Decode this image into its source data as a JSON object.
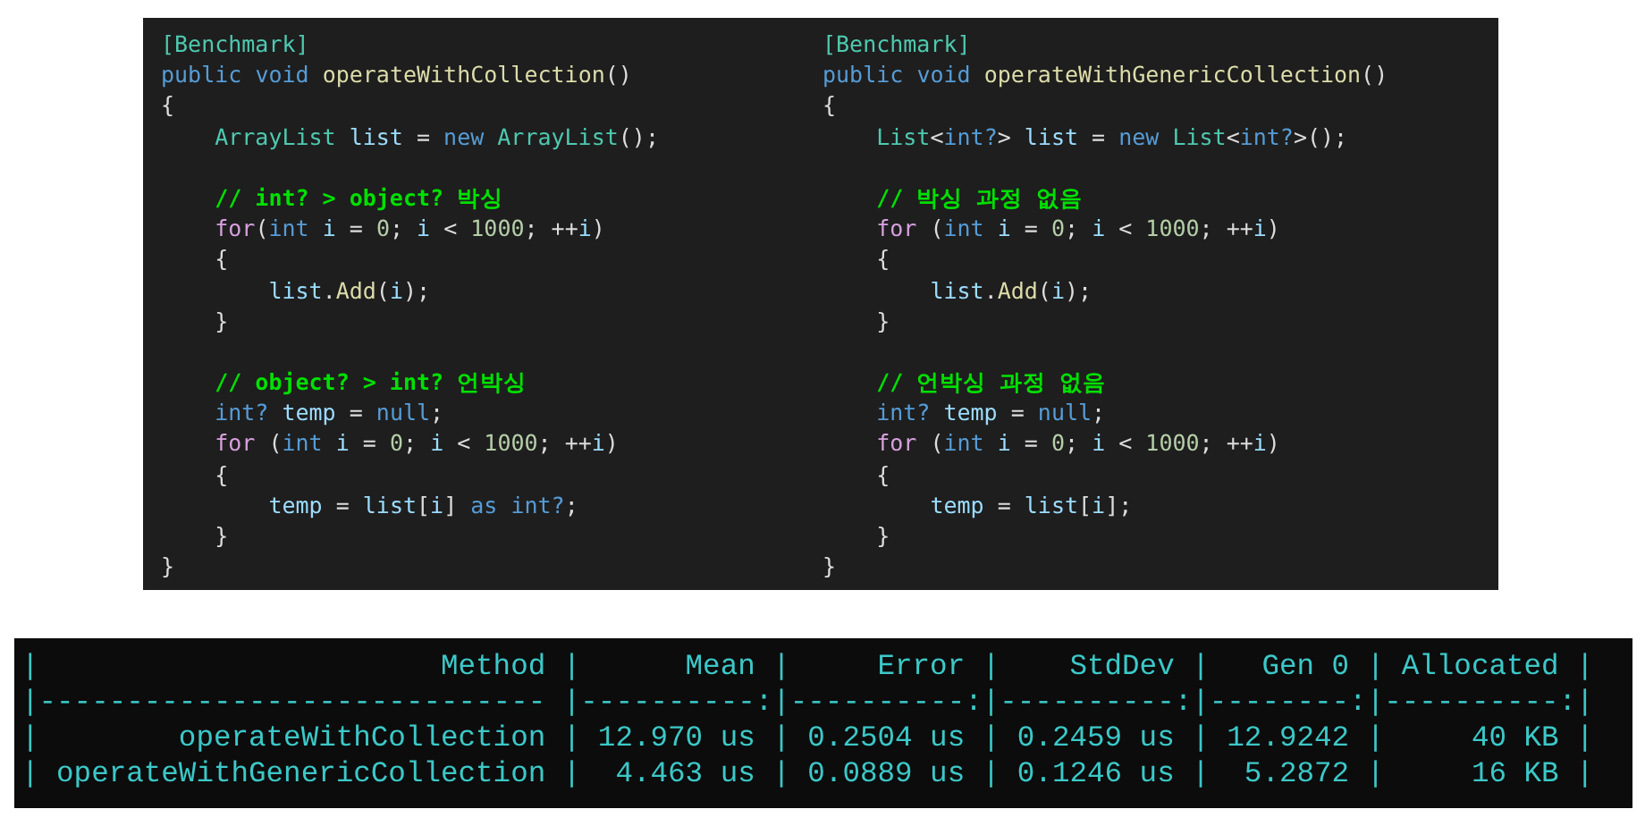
{
  "code_panels": [
    {
      "lines": [
        {
          "kind": "code",
          "tokens": [
            {
              "text": "[Benchmark]",
              "kind": "attr"
            }
          ]
        },
        {
          "kind": "code",
          "tokens": [
            {
              "text": "public ",
              "kind": "keyword"
            },
            {
              "text": "void ",
              "kind": "keyword"
            },
            {
              "text": "operateWithCollection",
              "kind": "method"
            },
            {
              "text": "()",
              "kind": "plain"
            }
          ]
        },
        {
          "kind": "code",
          "tokens": [
            {
              "text": "{",
              "kind": "plain"
            }
          ]
        },
        {
          "kind": "code",
          "tokens": [
            {
              "text": "    ArrayList ",
              "kind": "type"
            },
            {
              "text": "list",
              "kind": "ident"
            },
            {
              "text": " = ",
              "kind": "plain"
            },
            {
              "text": "new ",
              "kind": "keyword"
            },
            {
              "text": "ArrayList",
              "kind": "type"
            },
            {
              "text": "();",
              "kind": "plain"
            }
          ]
        },
        {
          "kind": "blank"
        },
        {
          "kind": "code",
          "tokens": [
            {
              "text": "    // int? > object? 박싱",
              "kind": "comment"
            }
          ]
        },
        {
          "kind": "code",
          "tokens": [
            {
              "text": "    for",
              "kind": "control"
            },
            {
              "text": "(",
              "kind": "plain"
            },
            {
              "text": "int ",
              "kind": "keyword"
            },
            {
              "text": "i",
              "kind": "ident"
            },
            {
              "text": " = ",
              "kind": "plain"
            },
            {
              "text": "0",
              "kind": "number"
            },
            {
              "text": "; ",
              "kind": "plain"
            },
            {
              "text": "i",
              "kind": "ident"
            },
            {
              "text": " < ",
              "kind": "plain"
            },
            {
              "text": "1000",
              "kind": "number"
            },
            {
              "text": "; ++",
              "kind": "plain"
            },
            {
              "text": "i",
              "kind": "ident"
            },
            {
              "text": ")",
              "kind": "plain"
            }
          ]
        },
        {
          "kind": "code",
          "tokens": [
            {
              "text": "    {",
              "kind": "plain"
            }
          ]
        },
        {
          "kind": "code",
          "tokens": [
            {
              "text": "        list",
              "kind": "ident"
            },
            {
              "text": ".",
              "kind": "plain"
            },
            {
              "text": "Add",
              "kind": "method"
            },
            {
              "text": "(",
              "kind": "plain"
            },
            {
              "text": "i",
              "kind": "ident"
            },
            {
              "text": ");",
              "kind": "plain"
            }
          ]
        },
        {
          "kind": "code",
          "tokens": [
            {
              "text": "    }",
              "kind": "plain"
            }
          ]
        },
        {
          "kind": "blank"
        },
        {
          "kind": "code",
          "tokens": [
            {
              "text": "    // object? > int? 언박싱",
              "kind": "comment"
            }
          ]
        },
        {
          "kind": "code",
          "tokens": [
            {
              "text": "    int? ",
              "kind": "keyword"
            },
            {
              "text": "temp",
              "kind": "ident"
            },
            {
              "text": " = ",
              "kind": "plain"
            },
            {
              "text": "null",
              "kind": "keyword"
            },
            {
              "text": ";",
              "kind": "plain"
            }
          ]
        },
        {
          "kind": "code",
          "tokens": [
            {
              "text": "    for",
              "kind": "control"
            },
            {
              "text": " (",
              "kind": "plain"
            },
            {
              "text": "int ",
              "kind": "keyword"
            },
            {
              "text": "i",
              "kind": "ident"
            },
            {
              "text": " = ",
              "kind": "plain"
            },
            {
              "text": "0",
              "kind": "number"
            },
            {
              "text": "; ",
              "kind": "plain"
            },
            {
              "text": "i",
              "kind": "ident"
            },
            {
              "text": " < ",
              "kind": "plain"
            },
            {
              "text": "1000",
              "kind": "number"
            },
            {
              "text": "; ++",
              "kind": "plain"
            },
            {
              "text": "i",
              "kind": "ident"
            },
            {
              "text": ")",
              "kind": "plain"
            }
          ]
        },
        {
          "kind": "code",
          "tokens": [
            {
              "text": "    {",
              "kind": "plain"
            }
          ]
        },
        {
          "kind": "code",
          "tokens": [
            {
              "text": "        temp",
              "kind": "ident"
            },
            {
              "text": " = ",
              "kind": "plain"
            },
            {
              "text": "list",
              "kind": "ident"
            },
            {
              "text": "[",
              "kind": "plain"
            },
            {
              "text": "i",
              "kind": "ident"
            },
            {
              "text": "] ",
              "kind": "plain"
            },
            {
              "text": "as int?",
              "kind": "keyword"
            },
            {
              "text": ";",
              "kind": "plain"
            }
          ]
        },
        {
          "kind": "code",
          "tokens": [
            {
              "text": "    }",
              "kind": "plain"
            }
          ]
        },
        {
          "kind": "code",
          "tokens": [
            {
              "text": "}",
              "kind": "plain"
            }
          ]
        }
      ]
    },
    {
      "lines": [
        {
          "kind": "code",
          "tokens": [
            {
              "text": "[Benchmark]",
              "kind": "attr"
            }
          ]
        },
        {
          "kind": "code",
          "tokens": [
            {
              "text": "public ",
              "kind": "keyword"
            },
            {
              "text": "void ",
              "kind": "keyword"
            },
            {
              "text": "operateWithGenericCollection",
              "kind": "method"
            },
            {
              "text": "()",
              "kind": "plain"
            }
          ]
        },
        {
          "kind": "code",
          "tokens": [
            {
              "text": "{",
              "kind": "plain"
            }
          ]
        },
        {
          "kind": "code",
          "tokens": [
            {
              "text": "    List",
              "kind": "type"
            },
            {
              "text": "<",
              "kind": "plain"
            },
            {
              "text": "int?",
              "kind": "keyword"
            },
            {
              "text": "> ",
              "kind": "plain"
            },
            {
              "text": "list",
              "kind": "ident"
            },
            {
              "text": " = ",
              "kind": "plain"
            },
            {
              "text": "new ",
              "kind": "keyword"
            },
            {
              "text": "List",
              "kind": "type"
            },
            {
              "text": "<",
              "kind": "plain"
            },
            {
              "text": "int?",
              "kind": "keyword"
            },
            {
              "text": ">();",
              "kind": "plain"
            }
          ]
        },
        {
          "kind": "blank"
        },
        {
          "kind": "code",
          "tokens": [
            {
              "text": "    // 박싱 과정 없음",
              "kind": "comment"
            }
          ]
        },
        {
          "kind": "code",
          "tokens": [
            {
              "text": "    for",
              "kind": "control"
            },
            {
              "text": " (",
              "kind": "plain"
            },
            {
              "text": "int ",
              "kind": "keyword"
            },
            {
              "text": "i",
              "kind": "ident"
            },
            {
              "text": " = ",
              "kind": "plain"
            },
            {
              "text": "0",
              "kind": "number"
            },
            {
              "text": "; ",
              "kind": "plain"
            },
            {
              "text": "i",
              "kind": "ident"
            },
            {
              "text": " < ",
              "kind": "plain"
            },
            {
              "text": "1000",
              "kind": "number"
            },
            {
              "text": "; ++",
              "kind": "plain"
            },
            {
              "text": "i",
              "kind": "ident"
            },
            {
              "text": ")",
              "kind": "plain"
            }
          ]
        },
        {
          "kind": "code",
          "tokens": [
            {
              "text": "    {",
              "kind": "plain"
            }
          ]
        },
        {
          "kind": "code",
          "tokens": [
            {
              "text": "        list",
              "kind": "ident"
            },
            {
              "text": ".",
              "kind": "plain"
            },
            {
              "text": "Add",
              "kind": "method"
            },
            {
              "text": "(",
              "kind": "plain"
            },
            {
              "text": "i",
              "kind": "ident"
            },
            {
              "text": ");",
              "kind": "plain"
            }
          ]
        },
        {
          "kind": "code",
          "tokens": [
            {
              "text": "    }",
              "kind": "plain"
            }
          ]
        },
        {
          "kind": "blank"
        },
        {
          "kind": "code",
          "tokens": [
            {
              "text": "    // 언박싱 과정 없음",
              "kind": "comment"
            }
          ]
        },
        {
          "kind": "code",
          "tokens": [
            {
              "text": "    int? ",
              "kind": "keyword"
            },
            {
              "text": "temp",
              "kind": "ident"
            },
            {
              "text": " = ",
              "kind": "plain"
            },
            {
              "text": "null",
              "kind": "keyword"
            },
            {
              "text": ";",
              "kind": "plain"
            }
          ]
        },
        {
          "kind": "code",
          "tokens": [
            {
              "text": "    for",
              "kind": "control"
            },
            {
              "text": " (",
              "kind": "plain"
            },
            {
              "text": "int ",
              "kind": "keyword"
            },
            {
              "text": "i",
              "kind": "ident"
            },
            {
              "text": " = ",
              "kind": "plain"
            },
            {
              "text": "0",
              "kind": "number"
            },
            {
              "text": "; ",
              "kind": "plain"
            },
            {
              "text": "i",
              "kind": "ident"
            },
            {
              "text": " < ",
              "kind": "plain"
            },
            {
              "text": "1000",
              "kind": "number"
            },
            {
              "text": "; ++",
              "kind": "plain"
            },
            {
              "text": "i",
              "kind": "ident"
            },
            {
              "text": ")",
              "kind": "plain"
            }
          ]
        },
        {
          "kind": "code",
          "tokens": [
            {
              "text": "    {",
              "kind": "plain"
            }
          ]
        },
        {
          "kind": "code",
          "tokens": [
            {
              "text": "        temp",
              "kind": "ident"
            },
            {
              "text": " = ",
              "kind": "plain"
            },
            {
              "text": "list",
              "kind": "ident"
            },
            {
              "text": "[",
              "kind": "plain"
            },
            {
              "text": "i",
              "kind": "ident"
            },
            {
              "text": "];",
              "kind": "plain"
            }
          ]
        },
        {
          "kind": "code",
          "tokens": [
            {
              "text": "    }",
              "kind": "plain"
            }
          ]
        },
        {
          "kind": "code",
          "tokens": [
            {
              "text": "}",
              "kind": "plain"
            }
          ]
        }
      ]
    }
  ],
  "terminal": {
    "lines": [
      "|                       Method |      Mean |     Error |    StdDev |   Gen 0 | Allocated |",
      "|----------------------------- |----------:|----------:|----------:|--------:|----------:|",
      "|        operateWithCollection | 12.970 us | 0.2504 us | 0.2459 us | 12.9242 |     40 KB |",
      "| operateWithGenericCollection |  4.463 us | 0.0889 us | 0.1246 us |  5.2872 |     16 KB |"
    ]
  }
}
